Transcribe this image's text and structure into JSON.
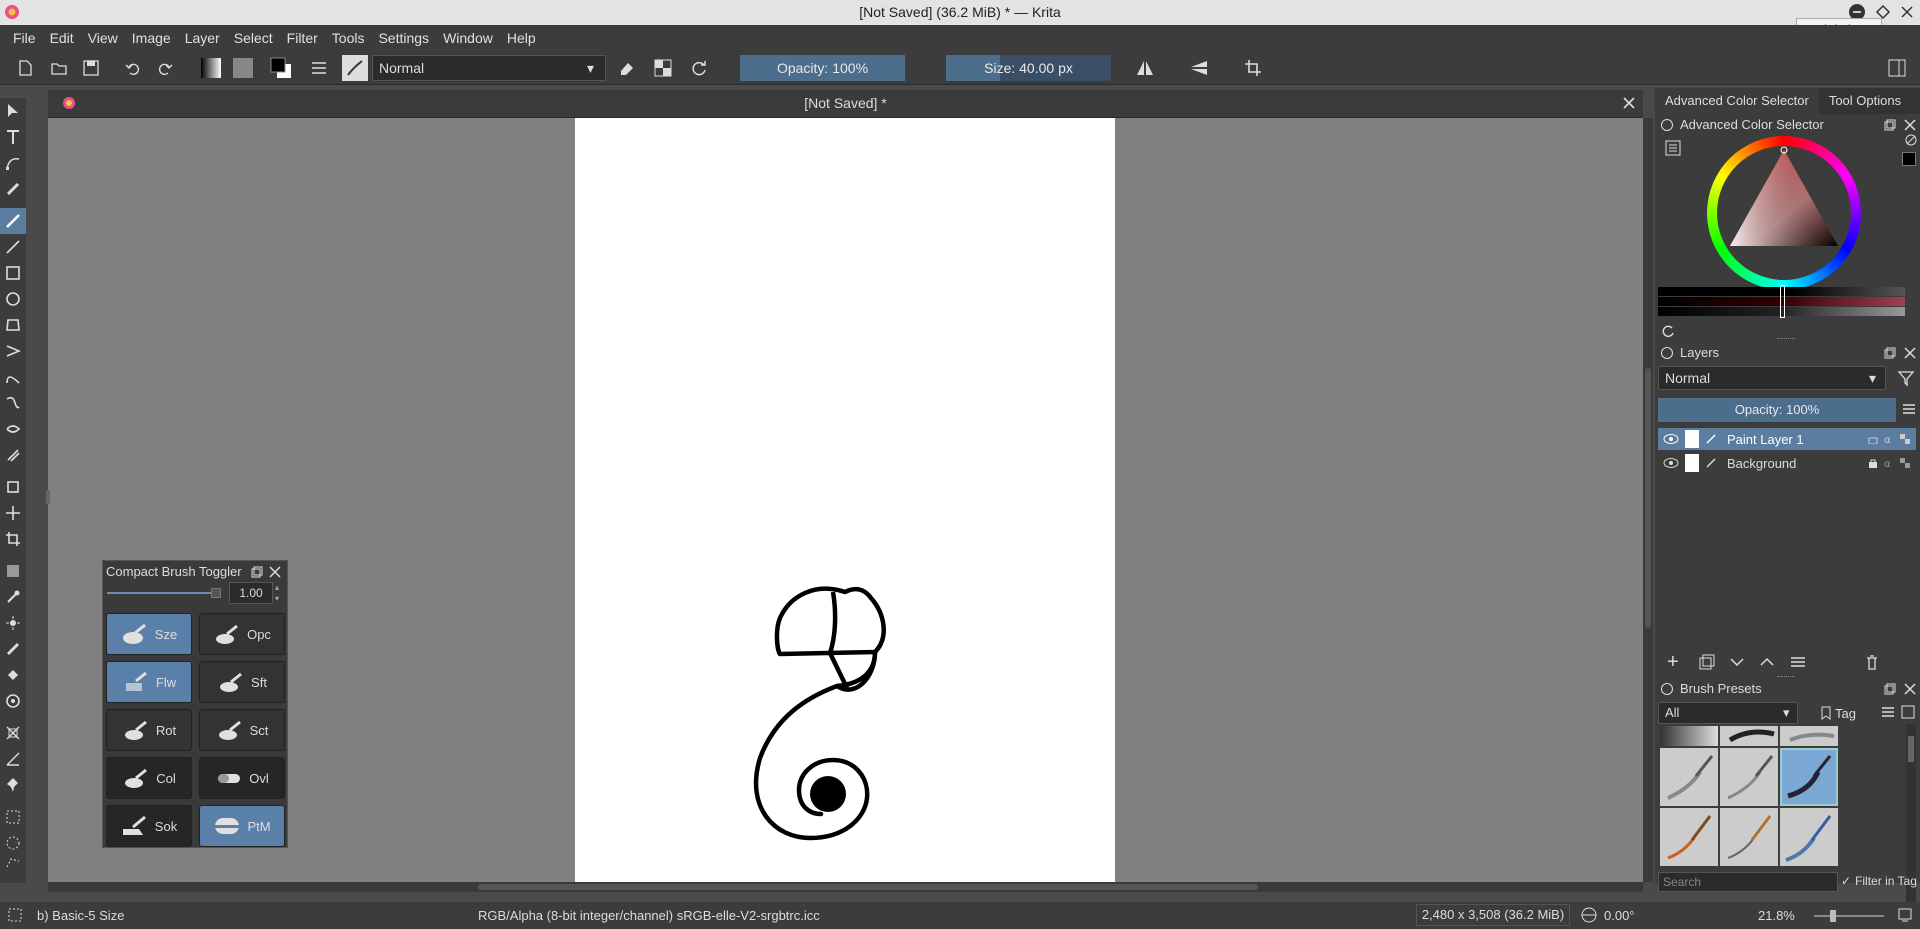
{
  "window": {
    "title": "[Not Saved] (36.2 MiB) * — Krita",
    "tooltip": "Minimize"
  },
  "menu": [
    "File",
    "Edit",
    "View",
    "Image",
    "Layer",
    "Select",
    "Filter",
    "Tools",
    "Settings",
    "Window",
    "Help"
  ],
  "toolbar": {
    "blend_mode": "Normal",
    "opacity": "Opacity: 100%",
    "size": "Size: 40.00 px"
  },
  "document": {
    "tab_title": "[Not Saved]  *"
  },
  "compact_brush_toggler": {
    "title": "Compact Brush Toggler",
    "value": "1.00",
    "buttons": [
      {
        "label": "Sze",
        "state": "on"
      },
      {
        "label": "Opc",
        "state": "off"
      },
      {
        "label": "Flw",
        "state": "on"
      },
      {
        "label": "Sft",
        "state": "off"
      },
      {
        "label": "Rot",
        "state": "off"
      },
      {
        "label": "Sct",
        "state": "off"
      },
      {
        "label": "Col",
        "state": "dark"
      },
      {
        "label": "Ovl",
        "state": "dark"
      },
      {
        "label": "Sok",
        "state": "dark"
      },
      {
        "label": "PtM",
        "state": "on"
      }
    ]
  },
  "right_dock": {
    "tabs": [
      "Advanced Color Selector",
      "Tool Options"
    ],
    "color_selector_title": "Advanced Color Selector",
    "layers": {
      "title": "Layers",
      "blend_mode": "Normal",
      "opacity": "Opacity:  100%",
      "items": [
        {
          "name": "Paint Layer 1",
          "selected": true
        },
        {
          "name": "Background",
          "selected": false
        }
      ]
    },
    "brush_presets": {
      "title": "Brush Presets",
      "filter": "All",
      "tag": "Tag",
      "search_placeholder": "Search",
      "filter_in_tag": "Filter in Tag"
    }
  },
  "statusbar": {
    "brush": "b) Basic-5 Size",
    "color_space": "RGB/Alpha (8-bit integer/channel)  sRGB-elle-V2-srgbtrc.icc",
    "dimensions": "2,480 x 3,508 (36.2 MiB)",
    "rotation": "0.00°",
    "zoom": "21.8%"
  },
  "colors": {
    "accent": "#5a80aa",
    "canvas_bg": "#808080",
    "panel_bg": "#3c3c3c"
  }
}
